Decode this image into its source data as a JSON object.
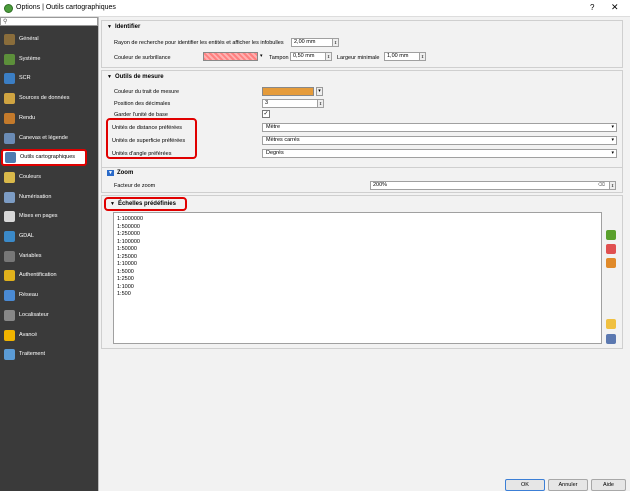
{
  "window": {
    "title": "Options | Outils cartographiques",
    "help_label": "?",
    "close_label": "✕"
  },
  "sidebar": {
    "search_placeholder": "",
    "items": [
      {
        "label": "Général",
        "icon": "wrench-icon",
        "color": "#8a6d3b"
      },
      {
        "label": "Système",
        "icon": "gear-icon",
        "color": "#5c8f3a"
      },
      {
        "label": "SCR",
        "icon": "globe-icon",
        "color": "#3b7ec4"
      },
      {
        "label": "Sources de données",
        "icon": "table-icon",
        "color": "#d0a441"
      },
      {
        "label": "Rendu",
        "icon": "paintbrush-icon",
        "color": "#c47a2b"
      },
      {
        "label": "Canevas et légende",
        "icon": "canvas-icon",
        "color": "#6a8bb5"
      },
      {
        "label": "Outils cartographiques",
        "icon": "map-tools-icon",
        "color": "#4e7cb0"
      },
      {
        "label": "Couleurs",
        "icon": "palette-icon",
        "color": "#d9b94a"
      },
      {
        "label": "Numérisation",
        "icon": "digitizing-icon",
        "color": "#7c9cc4"
      },
      {
        "label": "Mises en pages",
        "icon": "layout-icon",
        "color": "#d8d8d8"
      },
      {
        "label": "GDAL",
        "icon": "gdal-icon",
        "color": "#3b8ac9"
      },
      {
        "label": "Variables",
        "icon": "variables-icon",
        "color": "#777777"
      },
      {
        "label": "Authentification",
        "icon": "lock-icon",
        "color": "#e0b11c"
      },
      {
        "label": "Réseau",
        "icon": "network-icon",
        "color": "#4a8ad4"
      },
      {
        "label": "Localisateur",
        "icon": "search-icon",
        "color": "#888888"
      },
      {
        "label": "Avancé",
        "icon": "warning-icon",
        "color": "#f0b400"
      },
      {
        "label": "Traitement",
        "icon": "processing-gear-icon",
        "color": "#5b9bd5"
      }
    ]
  },
  "identifier": {
    "title": "Identifier",
    "radius_label": "Rayon de recherche pour identifier les entités et afficher les infobulles",
    "radius_value": "2,00 mm",
    "highlight_color_label": "Couleur de surbrillance",
    "buffer_label": "Tampon",
    "buffer_value": "0,50 mm",
    "min_width_label": "Largeur minimale",
    "min_width_value": "1,00 mm",
    "highlight_color": "#ff8080"
  },
  "measure": {
    "title": "Outils de mesure",
    "rubberband_color_label": "Couleur du trait de mesure",
    "rubberband_color": "#e59b3a",
    "decimal_places_label": "Position des décimales",
    "decimal_places_value": "3",
    "keep_base_unit_label": "Garder l'unité de base",
    "keep_base_unit_checked": "✓",
    "distance_units_label": "Unités de distance préférées",
    "distance_units_value": "Mètre",
    "area_units_label": "Unités de superficie préférées",
    "area_units_value": "Mètres carrés",
    "angle_units_label": "Unités d'angle préférées",
    "angle_units_value": "Degrés"
  },
  "zoom": {
    "title": "Zoom",
    "factor_label": "Facteur de zoom",
    "factor_value": "200%"
  },
  "scales": {
    "title": "Échelles prédéfinies",
    "items": [
      "1:1000000",
      "1:500000",
      "1:250000",
      "1:100000",
      "1:50000",
      "1:25000",
      "1:10000",
      "1:5000",
      "1:2500",
      "1:1000",
      "1:500"
    ]
  },
  "buttons": {
    "ok": "OK",
    "cancel": "Annuler",
    "help": "Aide"
  }
}
